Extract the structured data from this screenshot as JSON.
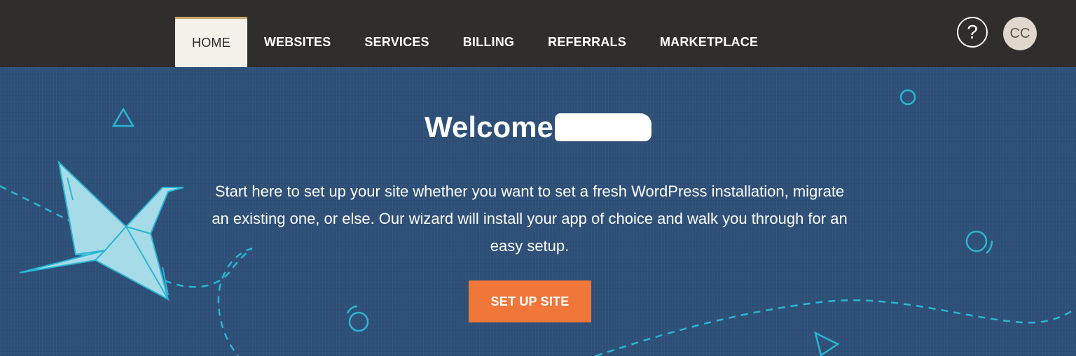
{
  "nav": {
    "items": [
      {
        "label": "HOME",
        "active": true
      },
      {
        "label": "WEBSITES",
        "active": false
      },
      {
        "label": "SERVICES",
        "active": false
      },
      {
        "label": "BILLING",
        "active": false
      },
      {
        "label": "REFERRALS",
        "active": false
      },
      {
        "label": "MARKETPLACE",
        "active": false
      }
    ],
    "help_label": "?",
    "avatar_initials": "CC"
  },
  "hero": {
    "title": "Welcome",
    "description": "Start here to set up your site whether you want to set a fresh WordPress installation, migrate an existing one, or else. Our wizard will install your app of choice and walk you through for an easy setup.",
    "cta_label": "SET UP SITE"
  },
  "colors": {
    "topbar": "#302e2c",
    "hero_bg": "#2e5078",
    "active_tab_bg": "#f4f1ea",
    "active_tab_accent": "#c9a76a",
    "cta": "#f0763a",
    "decoration": "#29b6d4",
    "crane": "#a8dbe8"
  },
  "icons": {
    "help": "question-circle-icon",
    "crane": "paper-crane-icon"
  }
}
